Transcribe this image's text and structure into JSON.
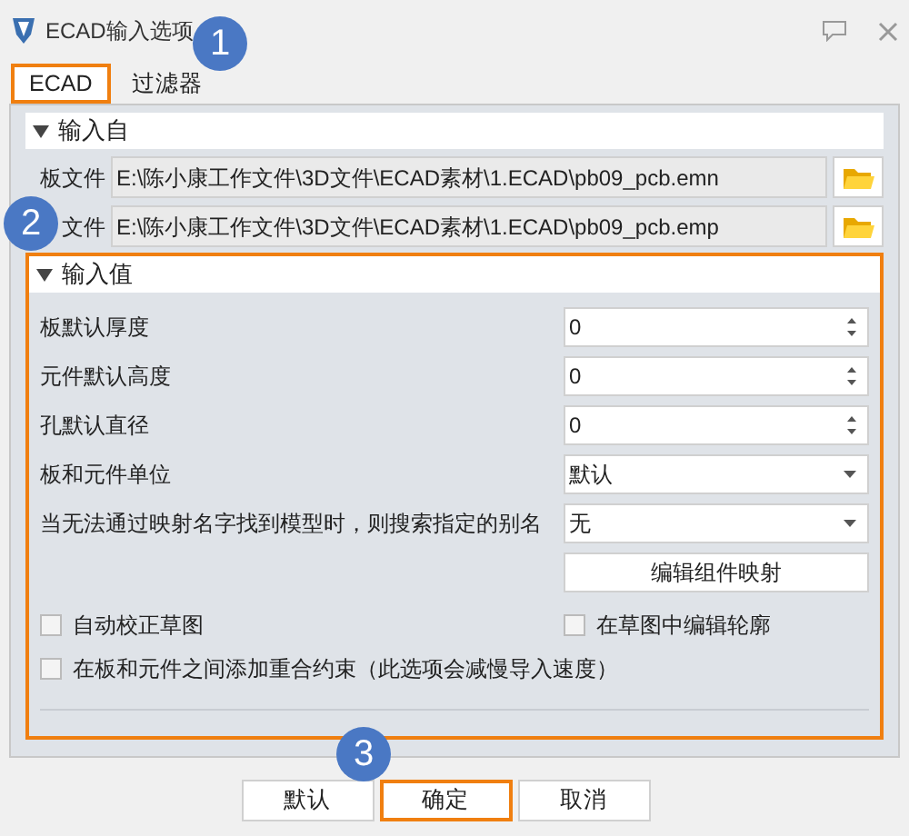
{
  "window": {
    "title": "ECAD输入选项"
  },
  "tabs": [
    {
      "label": "ECAD",
      "selected": true,
      "highlighted": true
    },
    {
      "label": "过滤器",
      "selected": false,
      "highlighted": false
    }
  ],
  "input_from": {
    "title": "输入自",
    "expanded": true,
    "files": [
      {
        "label": "板文件",
        "value": "E:\\陈小康工作文件\\3D文件\\ECAD素材\\1.ECAD\\pb09_pcb.emn"
      },
      {
        "label": "文件",
        "value": "E:\\陈小康工作文件\\3D文件\\ECAD素材\\1.ECAD\\pb09_pcb.emp"
      }
    ]
  },
  "input_values": {
    "title": "输入值",
    "expanded": true,
    "highlighted": true,
    "fields": [
      {
        "kind": "spin",
        "label": "板默认厚度",
        "value": "0"
      },
      {
        "kind": "spin",
        "label": "元件默认高度",
        "value": "0"
      },
      {
        "kind": "spin",
        "label": "孔默认直径",
        "value": "0"
      },
      {
        "kind": "dropdown",
        "label": "板和元件单位",
        "value": "默认"
      },
      {
        "kind": "dropdown",
        "label": "当无法通过映射名字找到模型时，则搜索指定的别名",
        "value": "无"
      }
    ],
    "mapping_button": "编辑组件映射",
    "checkboxes": [
      {
        "label": "自动校正草图",
        "checked": false
      },
      {
        "label": "在草图中编辑轮廓",
        "checked": false
      },
      {
        "label": "在板和元件之间添加重合约束（此选项会减慢导入速度）",
        "checked": false
      }
    ]
  },
  "buttons": [
    {
      "label": "默认",
      "highlighted": false
    },
    {
      "label": "确定",
      "highlighted": true
    },
    {
      "label": "取消",
      "highlighted": false
    }
  ],
  "callouts": [
    "1",
    "2",
    "3"
  ]
}
